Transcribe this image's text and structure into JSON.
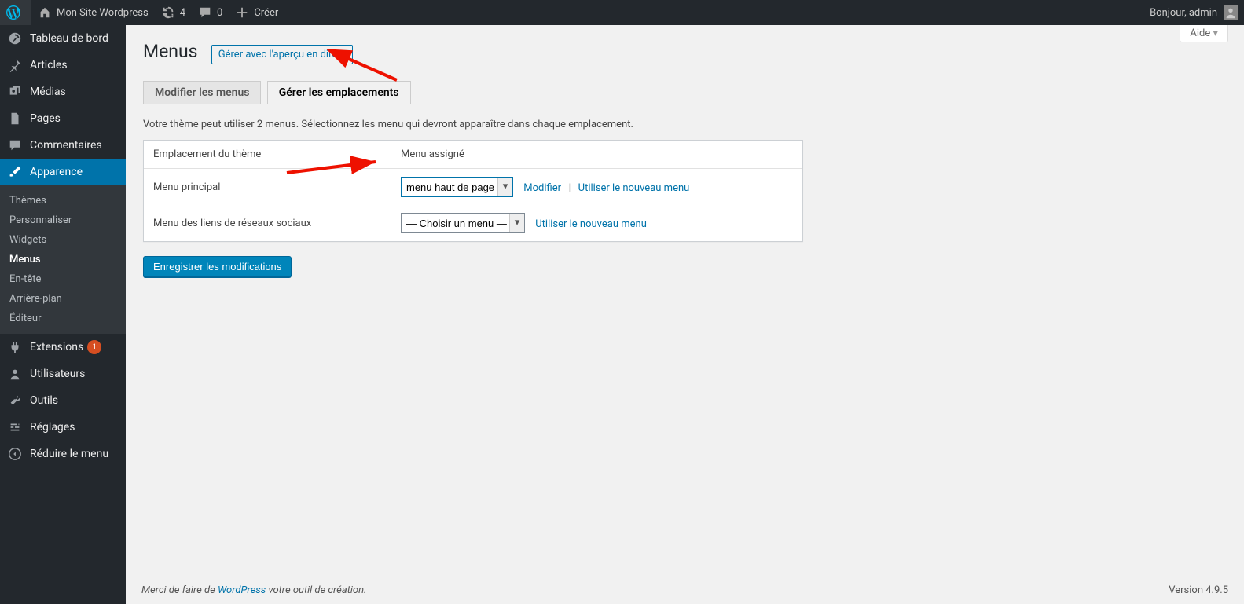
{
  "adminbar": {
    "site_name": "Mon Site Wordpress",
    "updates_count": "4",
    "comments_count": "0",
    "create_label": "Créer",
    "greeting": "Bonjour, admin"
  },
  "sidebar": {
    "dashboard": "Tableau de bord",
    "posts": "Articles",
    "media": "Médias",
    "pages": "Pages",
    "comments": "Commentaires",
    "appearance": "Apparence",
    "extensions": "Extensions",
    "extensions_badge": "1",
    "users": "Utilisateurs",
    "tools": "Outils",
    "settings": "Réglages",
    "collapse": "Réduire le menu",
    "appearance_sub": {
      "themes": "Thèmes",
      "customize": "Personnaliser",
      "widgets": "Widgets",
      "menus": "Menus",
      "header": "En-tête",
      "background": "Arrière-plan",
      "editor": "Éditeur"
    }
  },
  "screen": {
    "help": "Aide",
    "title": "Menus",
    "title_action": "Gérer avec l'aperçu en direct",
    "tab_edit": "Modifier les menus",
    "tab_locations": "Gérer les emplacements",
    "intro": "Votre thème peut utiliser 2 menus. Sélectionnez les menu qui devront apparaître dans chaque emplacement.",
    "th_location": "Emplacement du thème",
    "th_assigned": "Menu assigné",
    "row_main_label": "Menu principal",
    "row_main_selected": "menu haut de page",
    "row_main_edit": "Modifier",
    "row_main_new": "Utiliser le nouveau menu",
    "row_social_label": "Menu des liens de réseaux sociaux",
    "row_social_selected": "— Choisir un menu —",
    "row_social_new": "Utiliser le nouveau menu",
    "submit": "Enregistrer les modifications"
  },
  "footer": {
    "thanks_prefix": "Merci de faire de ",
    "thanks_link": "WordPress",
    "thanks_suffix": " votre outil de création.",
    "version": "Version 4.9.5"
  }
}
